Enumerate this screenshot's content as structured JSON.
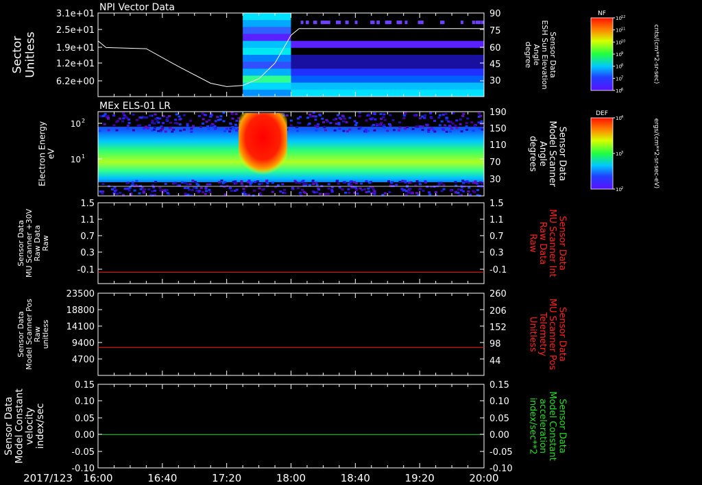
{
  "window": {
    "date_label": "2017/123"
  },
  "x_ticks": [
    "16:00",
    "16:40",
    "17:20",
    "18:00",
    "18:40",
    "19:20",
    "20:00"
  ],
  "panels": [
    {
      "title": "NPI Vector Data",
      "left_label": [
        "Sector",
        "Unitless"
      ],
      "left_ticks": [
        "3.1e+01",
        "2.5e+01",
        "1.9e+01",
        "1.2e+01",
        "6.2e+00"
      ],
      "right_label": [
        "Sensor Data",
        "ESH Sun Elevation",
        "Angle",
        "degree"
      ],
      "right_label_color": "#ffffff",
      "right_ticks": [
        "90",
        "75",
        "60",
        "45",
        "30"
      ]
    },
    {
      "title": "MEx ELS-01 LR",
      "left_label": [
        "Electron Energy",
        "eV"
      ],
      "left_ticks": [
        "10",
        "10"
      ],
      "left_tick_exp": [
        "2",
        "1"
      ],
      "right_label": [
        "Sensor Data",
        "Model Scanner",
        "Angle",
        "degrees"
      ],
      "right_label_color": "#ffffff",
      "right_ticks": [
        "190",
        "150",
        "110",
        "70",
        "30"
      ]
    },
    {
      "title": "",
      "left_label": [
        "Sensor Data",
        "MU Scanner +30V",
        "Raw Data",
        "Raw"
      ],
      "left_ticks": [
        "1.5",
        "1.1",
        "0.7",
        "0.3",
        "-0.1"
      ],
      "right_label": [
        "Sensor Data",
        "MU Scanner Int",
        "Raw Data",
        "Raw"
      ],
      "right_label_color": "#ff2020",
      "right_ticks": [
        "1.5",
        "1.1",
        "0.7",
        "0.3",
        "-0.1"
      ]
    },
    {
      "title": "",
      "left_label": [
        "Sensor Data",
        "Model Scanner Pos",
        "Raw",
        "unitless"
      ],
      "left_ticks": [
        "23500",
        "18800",
        "14100",
        "9400",
        "4700"
      ],
      "right_label": [
        "Sensor Data",
        "MU Scanner Pos",
        "Telemetry",
        "Unitless"
      ],
      "right_label_color": "#ff2020",
      "right_ticks": [
        "260",
        "206",
        "152",
        "98",
        "44"
      ]
    },
    {
      "title": "",
      "left_label": [
        "Sensor Data",
        "Model Constant",
        "velocity",
        "index/sec"
      ],
      "left_ticks": [
        "0.15",
        "0.10",
        "0.05",
        "0.00",
        "-0.05",
        "-0.10"
      ],
      "right_label": [
        "Sensor Data",
        "Model Constant",
        "acceleration",
        "index/sec**2"
      ],
      "right_label_color": "#20e020",
      "right_ticks": [
        "0.15",
        "0.10",
        "0.05",
        "0.00",
        "-0.05",
        "-0.10"
      ]
    }
  ],
  "colorbars": [
    {
      "title": "NF",
      "unit": "cnts/(cm**2-sr-sec)",
      "ticks": [
        "10",
        "10",
        "10",
        "10",
        "10",
        "10",
        "10"
      ],
      "tick_exp": [
        "12",
        "11",
        "10",
        "9",
        "8",
        "7",
        "6"
      ]
    },
    {
      "title": "DEF",
      "unit": "ergs/(cm**2-sr-sec-eV)",
      "ticks": [
        "10",
        "10",
        "10"
      ],
      "tick_exp": [
        "4",
        "3",
        "2"
      ]
    }
  ],
  "colors": {
    "line_white": "#ffffff",
    "line_red": "#ff2020",
    "line_green": "#20e020"
  },
  "chart_data": [
    {
      "type": "heatmap",
      "title": "NPI Vector Data",
      "ylabel": "Sector Unitless",
      "y2label": "Sensor Data ESH Sun Elevation Angle degree",
      "x": [
        "16:00",
        "16:20",
        "16:40",
        "17:00",
        "17:20",
        "17:35",
        "17:50",
        "18:00",
        "18:20",
        "18:40",
        "19:00",
        "19:20",
        "19:40",
        "20:00"
      ],
      "series": [
        {
          "name": "ESH Sun Elevation",
          "type": "line",
          "x": [
            "16:00",
            "16:05",
            "16:30",
            "16:50",
            "17:10",
            "17:20",
            "17:30",
            "17:40",
            "17:50",
            "18:00",
            "18:05",
            "18:20",
            "19:00",
            "20:00"
          ],
          "values": [
            65,
            59,
            58,
            42,
            27,
            24,
            25,
            31,
            45,
            70,
            76,
            76,
            76,
            76
          ]
        }
      ],
      "heatmap_start": "17:30",
      "y2lim": [
        15,
        90
      ]
    },
    {
      "type": "heatmap",
      "title": "MEx ELS-01 LR",
      "ylabel": "Electron Energy eV",
      "y2label": "Sensor Data Model Scanner Angle degrees",
      "burst_interval": [
        "17:30",
        "17:55"
      ],
      "y2lim": [
        0,
        190
      ]
    },
    {
      "type": "line",
      "ylabel": "Sensor Data MU Scanner +30V Raw Data Raw",
      "y2label": "Sensor Data MU Scanner Int Raw Data Raw",
      "x": [
        "16:00",
        "20:00"
      ],
      "values": [
        -0.13,
        -0.13
      ],
      "ylim": [
        -0.4,
        1.5
      ]
    },
    {
      "type": "line",
      "ylabel": "Sensor Data Model Scanner Pos Raw unitless",
      "y2label": "Sensor Data MU Scanner Pos Telemetry Unitless",
      "x": [
        "16:00",
        "20:00"
      ],
      "values": [
        8000,
        8000
      ],
      "ylim": [
        0,
        23500
      ]
    },
    {
      "type": "line",
      "ylabel": "Sensor Data Model Constant velocity index/sec",
      "y2label": "Sensor Data Model Constant acceleration index/sec**2",
      "x": [
        "16:00",
        "20:00"
      ],
      "values": [
        0.0,
        0.0
      ],
      "ylim": [
        -0.1,
        0.15
      ]
    }
  ]
}
